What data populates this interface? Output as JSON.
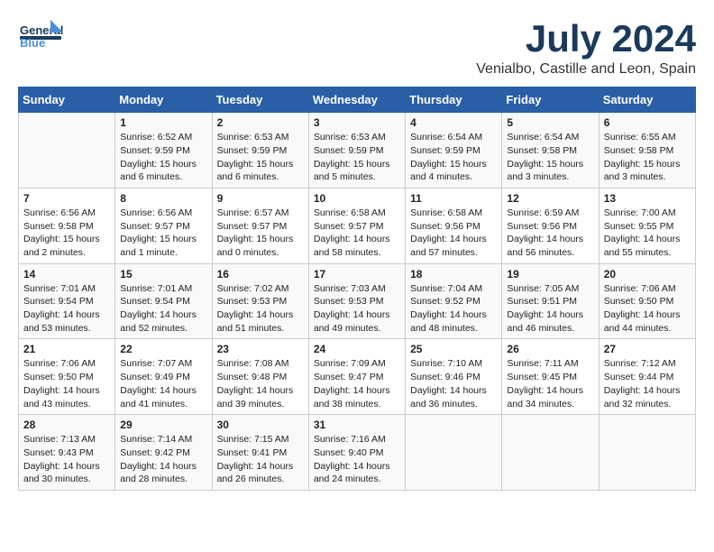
{
  "header": {
    "logo_line1": "General",
    "logo_line2": "Blue",
    "month_year": "July 2024",
    "location": "Venialbo, Castille and Leon, Spain"
  },
  "days_of_week": [
    "Sunday",
    "Monday",
    "Tuesday",
    "Wednesday",
    "Thursday",
    "Friday",
    "Saturday"
  ],
  "weeks": [
    [
      {
        "day": "",
        "content": ""
      },
      {
        "day": "1",
        "content": "Sunrise: 6:52 AM\nSunset: 9:59 PM\nDaylight: 15 hours\nand 6 minutes."
      },
      {
        "day": "2",
        "content": "Sunrise: 6:53 AM\nSunset: 9:59 PM\nDaylight: 15 hours\nand 6 minutes."
      },
      {
        "day": "3",
        "content": "Sunrise: 6:53 AM\nSunset: 9:59 PM\nDaylight: 15 hours\nand 5 minutes."
      },
      {
        "day": "4",
        "content": "Sunrise: 6:54 AM\nSunset: 9:59 PM\nDaylight: 15 hours\nand 4 minutes."
      },
      {
        "day": "5",
        "content": "Sunrise: 6:54 AM\nSunset: 9:58 PM\nDaylight: 15 hours\nand 3 minutes."
      },
      {
        "day": "6",
        "content": "Sunrise: 6:55 AM\nSunset: 9:58 PM\nDaylight: 15 hours\nand 3 minutes."
      }
    ],
    [
      {
        "day": "7",
        "content": "Sunrise: 6:56 AM\nSunset: 9:58 PM\nDaylight: 15 hours\nand 2 minutes."
      },
      {
        "day": "8",
        "content": "Sunrise: 6:56 AM\nSunset: 9:57 PM\nDaylight: 15 hours\nand 1 minute."
      },
      {
        "day": "9",
        "content": "Sunrise: 6:57 AM\nSunset: 9:57 PM\nDaylight: 15 hours\nand 0 minutes."
      },
      {
        "day": "10",
        "content": "Sunrise: 6:58 AM\nSunset: 9:57 PM\nDaylight: 14 hours\nand 58 minutes."
      },
      {
        "day": "11",
        "content": "Sunrise: 6:58 AM\nSunset: 9:56 PM\nDaylight: 14 hours\nand 57 minutes."
      },
      {
        "day": "12",
        "content": "Sunrise: 6:59 AM\nSunset: 9:56 PM\nDaylight: 14 hours\nand 56 minutes."
      },
      {
        "day": "13",
        "content": "Sunrise: 7:00 AM\nSunset: 9:55 PM\nDaylight: 14 hours\nand 55 minutes."
      }
    ],
    [
      {
        "day": "14",
        "content": "Sunrise: 7:01 AM\nSunset: 9:54 PM\nDaylight: 14 hours\nand 53 minutes."
      },
      {
        "day": "15",
        "content": "Sunrise: 7:01 AM\nSunset: 9:54 PM\nDaylight: 14 hours\nand 52 minutes."
      },
      {
        "day": "16",
        "content": "Sunrise: 7:02 AM\nSunset: 9:53 PM\nDaylight: 14 hours\nand 51 minutes."
      },
      {
        "day": "17",
        "content": "Sunrise: 7:03 AM\nSunset: 9:53 PM\nDaylight: 14 hours\nand 49 minutes."
      },
      {
        "day": "18",
        "content": "Sunrise: 7:04 AM\nSunset: 9:52 PM\nDaylight: 14 hours\nand 48 minutes."
      },
      {
        "day": "19",
        "content": "Sunrise: 7:05 AM\nSunset: 9:51 PM\nDaylight: 14 hours\nand 46 minutes."
      },
      {
        "day": "20",
        "content": "Sunrise: 7:06 AM\nSunset: 9:50 PM\nDaylight: 14 hours\nand 44 minutes."
      }
    ],
    [
      {
        "day": "21",
        "content": "Sunrise: 7:06 AM\nSunset: 9:50 PM\nDaylight: 14 hours\nand 43 minutes."
      },
      {
        "day": "22",
        "content": "Sunrise: 7:07 AM\nSunset: 9:49 PM\nDaylight: 14 hours\nand 41 minutes."
      },
      {
        "day": "23",
        "content": "Sunrise: 7:08 AM\nSunset: 9:48 PM\nDaylight: 14 hours\nand 39 minutes."
      },
      {
        "day": "24",
        "content": "Sunrise: 7:09 AM\nSunset: 9:47 PM\nDaylight: 14 hours\nand 38 minutes."
      },
      {
        "day": "25",
        "content": "Sunrise: 7:10 AM\nSunset: 9:46 PM\nDaylight: 14 hours\nand 36 minutes."
      },
      {
        "day": "26",
        "content": "Sunrise: 7:11 AM\nSunset: 9:45 PM\nDaylight: 14 hours\nand 34 minutes."
      },
      {
        "day": "27",
        "content": "Sunrise: 7:12 AM\nSunset: 9:44 PM\nDaylight: 14 hours\nand 32 minutes."
      }
    ],
    [
      {
        "day": "28",
        "content": "Sunrise: 7:13 AM\nSunset: 9:43 PM\nDaylight: 14 hours\nand 30 minutes."
      },
      {
        "day": "29",
        "content": "Sunrise: 7:14 AM\nSunset: 9:42 PM\nDaylight: 14 hours\nand 28 minutes."
      },
      {
        "day": "30",
        "content": "Sunrise: 7:15 AM\nSunset: 9:41 PM\nDaylight: 14 hours\nand 26 minutes."
      },
      {
        "day": "31",
        "content": "Sunrise: 7:16 AM\nSunset: 9:40 PM\nDaylight: 14 hours\nand 24 minutes."
      },
      {
        "day": "",
        "content": ""
      },
      {
        "day": "",
        "content": ""
      },
      {
        "day": "",
        "content": ""
      }
    ]
  ]
}
